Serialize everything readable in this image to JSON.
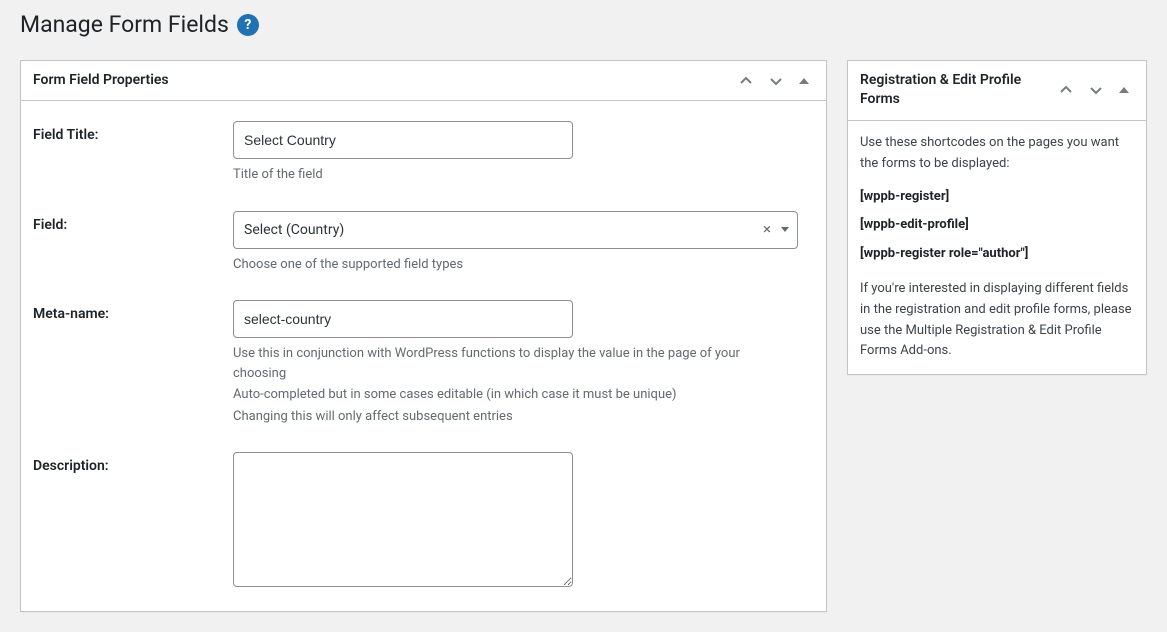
{
  "page": {
    "title": "Manage Form Fields",
    "help_tooltip": "?"
  },
  "mainbox": {
    "title": "Form Field Properties",
    "rows": {
      "field_title": {
        "label": "Field Title:",
        "value": "Select Country",
        "help": "Title of the field"
      },
      "field": {
        "label": "Field:",
        "value": "Select (Country)",
        "help": "Choose one of the supported field types"
      },
      "meta_name": {
        "label": "Meta-name:",
        "value": "select-country",
        "help1": "Use this in conjunction with WordPress functions to display the value in the page of your choosing",
        "help2": "Auto-completed but in some cases editable (in which case it must be unique)",
        "help3": "Changing this will only affect subsequent entries"
      },
      "description": {
        "label": "Description:",
        "value": ""
      }
    }
  },
  "sidebar": {
    "title": "Registration & Edit Profile Forms",
    "intro": "Use these shortcodes on the pages you want the forms to be displayed:",
    "shortcodes": [
      "[wppb-register]",
      "[wppb-edit-profile]",
      "[wppb-register role=\"author\"]"
    ],
    "footer": "If you're interested in displaying different fields in the registration and edit profile forms, please use the Multiple Registration & Edit Profile Forms Add-ons."
  }
}
